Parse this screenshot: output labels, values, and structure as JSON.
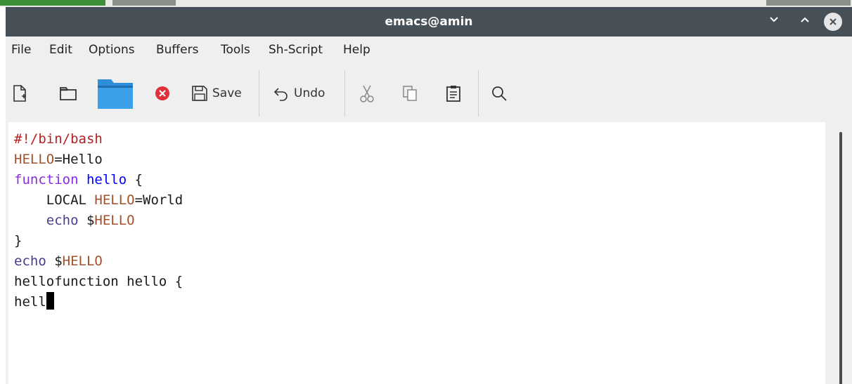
{
  "window": {
    "title": "emacs@amin"
  },
  "menubar": {
    "items": [
      "File",
      "Edit",
      "Options",
      "Buffers",
      "Tools",
      "Sh-Script",
      "Help"
    ]
  },
  "toolbar": {
    "save_label": "Save",
    "undo_label": "Undo",
    "icons": [
      "new-file-icon",
      "open-folder-icon",
      "file-manager-folder-icon",
      "close-buffer-icon",
      "save-icon",
      "undo-icon",
      "cut-icon",
      "copy-icon",
      "paste-icon",
      "search-icon"
    ],
    "close_color": "#e0303a",
    "folder_color": "#2c8fd8"
  },
  "editor": {
    "lines": [
      [
        {
          "t": "#!/bin/bash",
          "c": "comment"
        }
      ],
      [
        {
          "t": "HELLO",
          "c": "var"
        },
        {
          "t": "=Hello",
          "c": "plain"
        }
      ],
      [
        {
          "t": "function",
          "c": "kw"
        },
        {
          "t": " ",
          "c": "plain"
        },
        {
          "t": "hello",
          "c": "fn"
        },
        {
          "t": " {",
          "c": "plain"
        }
      ],
      [
        {
          "t": "    LOCAL ",
          "c": "plain"
        },
        {
          "t": "HELLO",
          "c": "var"
        },
        {
          "t": "=World",
          "c": "plain"
        }
      ],
      [
        {
          "t": "    ",
          "c": "plain"
        },
        {
          "t": "echo",
          "c": "builtin"
        },
        {
          "t": " $",
          "c": "plain"
        },
        {
          "t": "HELLO",
          "c": "var"
        }
      ],
      [
        {
          "t": "}",
          "c": "plain"
        }
      ],
      [
        {
          "t": "echo",
          "c": "builtin"
        },
        {
          "t": " $",
          "c": "plain"
        },
        {
          "t": "HELLO",
          "c": "var"
        }
      ],
      [
        {
          "t": "hellofunction hello {",
          "c": "plain"
        }
      ],
      [
        {
          "t": "hell",
          "c": "plain"
        }
      ]
    ],
    "cursor_line": 8
  }
}
